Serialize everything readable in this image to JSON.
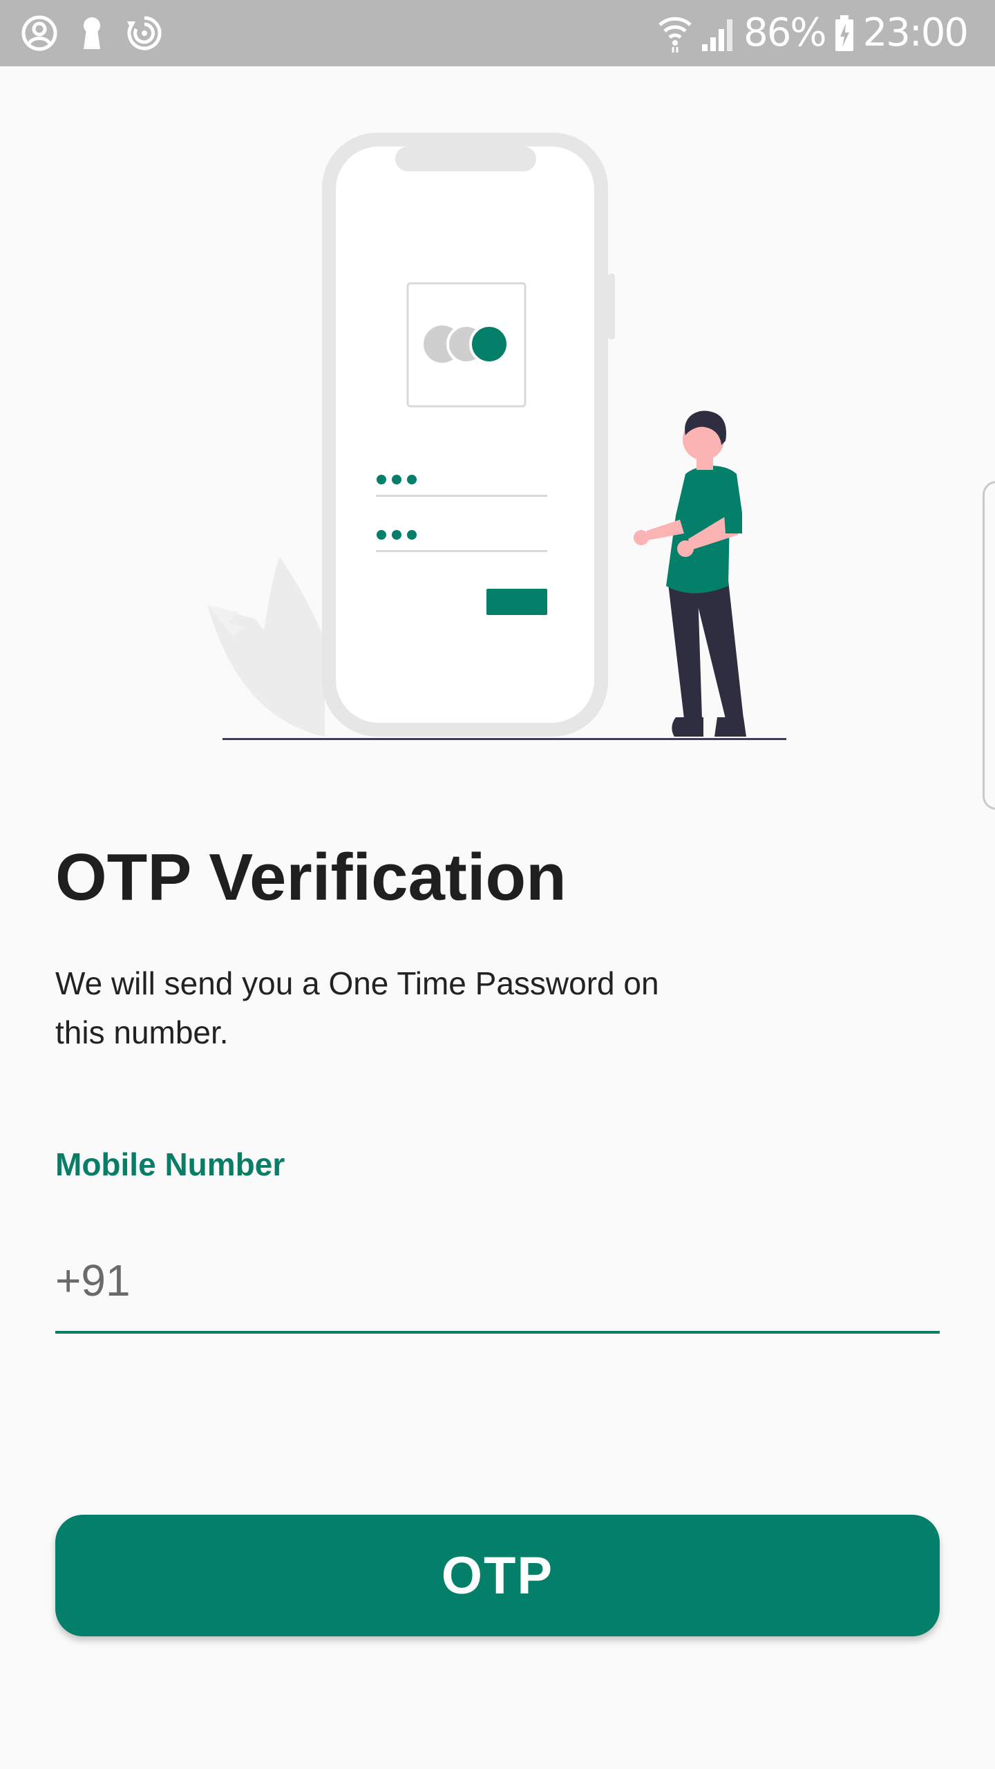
{
  "status_bar": {
    "battery": "86%",
    "time": "23:00",
    "icons": [
      "account-circle-icon",
      "keyhole-icon",
      "sync-icon",
      "wifi-icon",
      "signal-icon",
      "battery-charging-icon"
    ]
  },
  "illustration": {
    "name": "phone-with-person-illustration",
    "colors": {
      "accent": "#047f69",
      "phone_frame": "#e6e6e6",
      "screen": "#ffffff",
      "dark": "#2f2e41",
      "skin": "#fbb3b3"
    }
  },
  "main": {
    "title": "OTP Verification",
    "subtitle": "We will send you a One Time Password on this number.",
    "field_label": "Mobile Number",
    "phone_placeholder": "+91",
    "button_label": "OTP"
  },
  "colors": {
    "accent": "#047f69",
    "label": "#0a7d67",
    "background": "#fafafa",
    "status_bar": "#b7b7b7"
  }
}
